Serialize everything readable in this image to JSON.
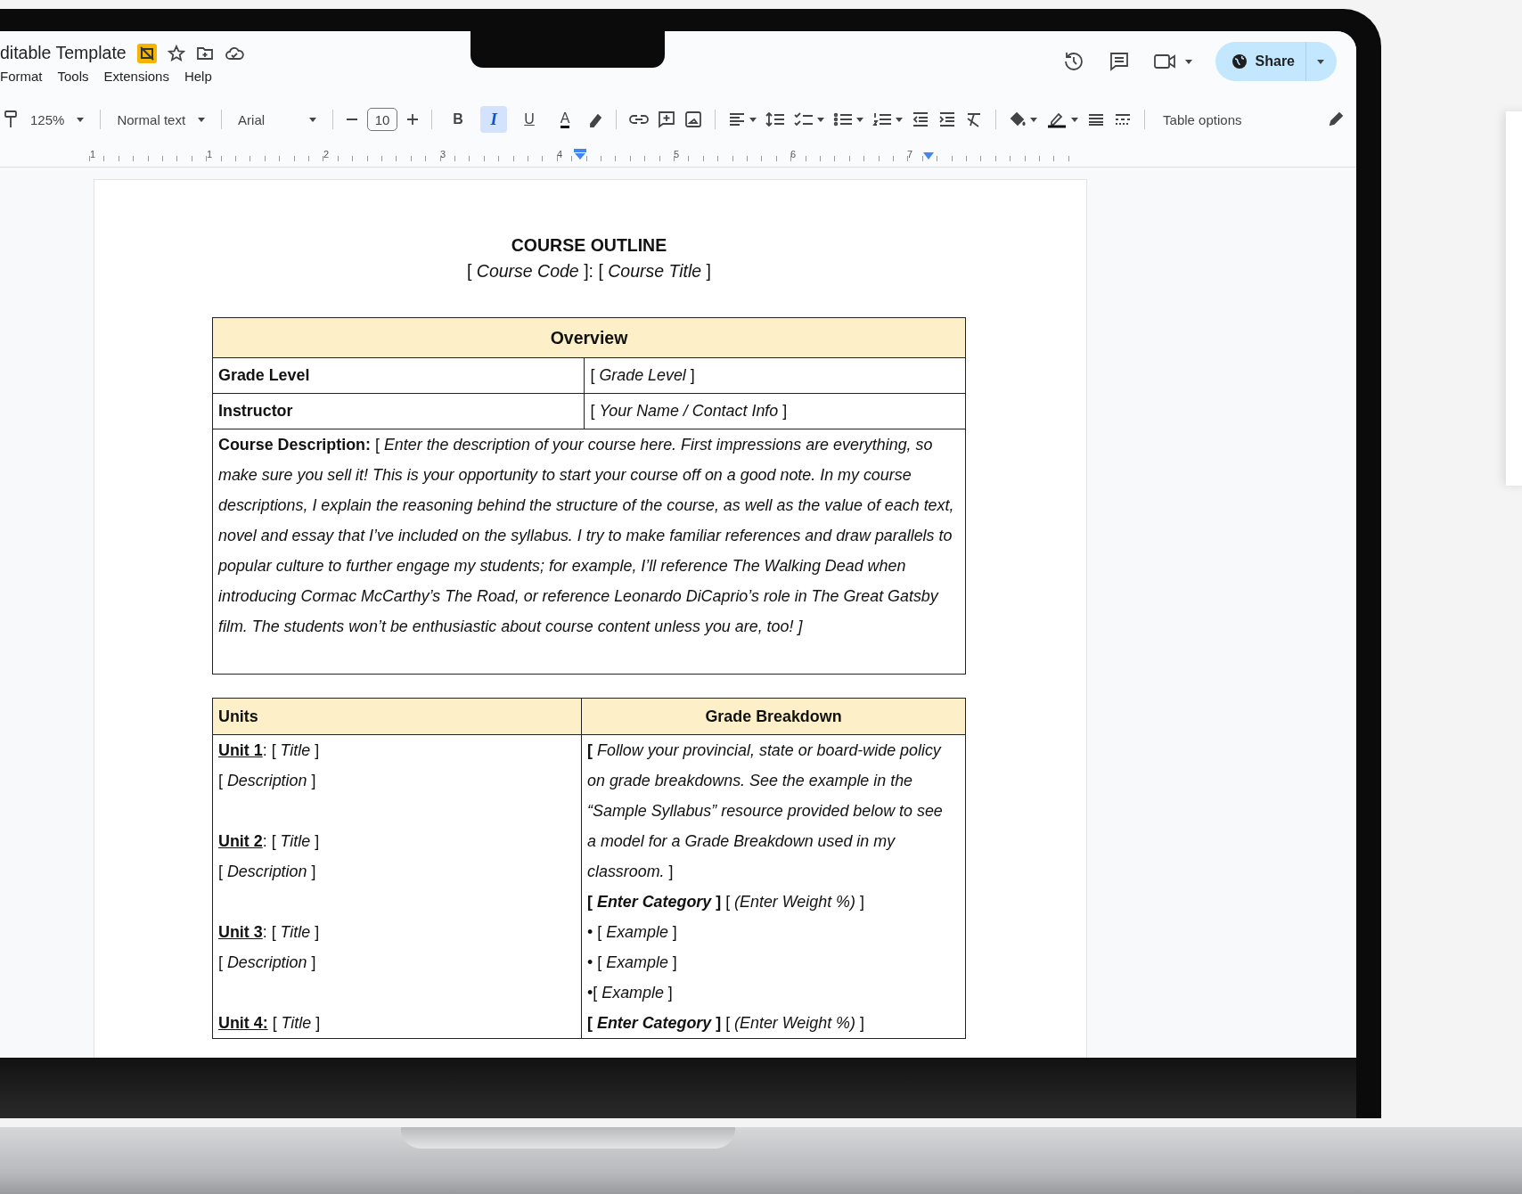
{
  "header": {
    "title": "ditable Template",
    "menu": [
      "Format",
      "Tools",
      "Extensions",
      "Help"
    ],
    "share": "Share"
  },
  "toolbar": {
    "zoom": "125%",
    "style": "Normal text",
    "font": "Arial",
    "font_size": "10",
    "format_buttons": [
      {
        "label": "B",
        "selected": false
      },
      {
        "label": "I",
        "selected": true
      },
      {
        "label": "U",
        "selected": false
      },
      {
        "label": "A",
        "selected": false
      }
    ],
    "table_options": "Table options"
  },
  "ruler": [
    "1",
    "1",
    "2",
    "3",
    "4",
    "5",
    "6",
    "7"
  ],
  "document": {
    "heading": "COURSE OUTLINE",
    "subtitle": "[ *Course Code* ]: [ *Course Title* ]",
    "overview": {
      "header": "Overview",
      "rows": [
        {
          "label": "Grade Level",
          "value": "[ *Grade Level* ]"
        },
        {
          "label": "Instructor",
          "value": "[ *Your Name / Contact Info* ]"
        }
      ],
      "description": "**Course Description:** [ *Enter the description of your course here.  First impressions are everything, so make sure you sell it!  This is your opportunity to start your course off on a good note.  In my course descriptions, I explain the reasoning behind the structure of the course, as well as the value of each text, novel and essay that I’ve included on the syllabus.  I try to make familiar references and draw parallels to popular culture to further engage my students; for example, I’ll reference The Walking Dead when introducing Cormac McCarthy’s The Road, or reference Leonardo DiCaprio’s role in The Great Gatsby film.  The students won’t be enthusiastic about course content unless you are, too! ]*"
    },
    "units_table": {
      "columns": [
        "Units",
        "Grade Breakdown"
      ],
      "units": [
        {
          "name": "Unit 1",
          "title": ": [ *Title* ]",
          "description": "[ *Description* ]"
        },
        {
          "name": "Unit 2",
          "title": ": [ *Title* ]",
          "description": "[ *Description* ]"
        },
        {
          "name": "Unit 3",
          "title": ": [ *Title* ]",
          "description": "[ *Description* ]"
        },
        {
          "name": "Unit 4:",
          "title": " [ *Title* ]"
        }
      ],
      "breakdown": [
        {
          "kind": "paragraph",
          "text": "**[** *Follow your provincial, state or board-wide policy on grade breakdowns.  See the example in the “Sample Syllabus” resource provided below to see a model for a Grade Breakdown used in my classroom.* ]"
        },
        {
          "kind": "line",
          "text": "**[ *Enter Category* ]** [ *(Enter Weight %)* ]"
        },
        {
          "kind": "line",
          "text": "• [ *Example* ]"
        },
        {
          "kind": "line",
          "text": "• [ *Example* ]"
        },
        {
          "kind": "line",
          "text": "•[ *Example* ]"
        },
        {
          "kind": "line",
          "text": "**[ *Enter Category* ]** [ *(Enter Weight %)* ]"
        }
      ]
    }
  }
}
